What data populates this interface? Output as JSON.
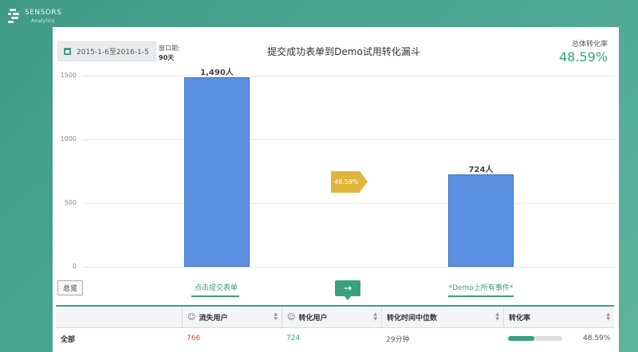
{
  "logo": {
    "name": "SENSORS",
    "sub": "Analytics"
  },
  "date_range": "2015-1-6至2016-1-5",
  "window_label": "窗口期:",
  "window_value": "90天",
  "title": "提交成功表单到Demo试用转化漏斗",
  "overall_label": "总体转化率",
  "overall_value": "48.59%",
  "chart_data": {
    "type": "bar",
    "title": "提交成功表单到Demo试用转化漏斗",
    "categories": [
      "点击提交表单",
      "*Demo上所有事件*"
    ],
    "values": [
      1490,
      724
    ],
    "bar_labels": [
      "1,490人",
      "724人"
    ],
    "y_ticks": [
      "1500",
      "1000",
      "500",
      "0"
    ],
    "ylim": [
      0,
      1500
    ],
    "conversion_tag": "48.59%",
    "grid": true
  },
  "buttons": {
    "overview": "总览",
    "arrow": "→"
  },
  "steps": [
    "点击提交表单",
    "*Demo上所有事件*"
  ],
  "table": {
    "headers": [
      "",
      "流失用户",
      "转化用户",
      "转化时间中位数",
      "转化率"
    ],
    "row": {
      "name": "全部",
      "lost": "766",
      "converted": "724",
      "median": "29分钟",
      "rate": "48.59%",
      "rate_fraction": 0.4859
    }
  },
  "colors": {
    "accent": "#3aa07f",
    "bar": "#5b8fe0",
    "tag": "#e2b33a",
    "lost": "#d9572b"
  }
}
